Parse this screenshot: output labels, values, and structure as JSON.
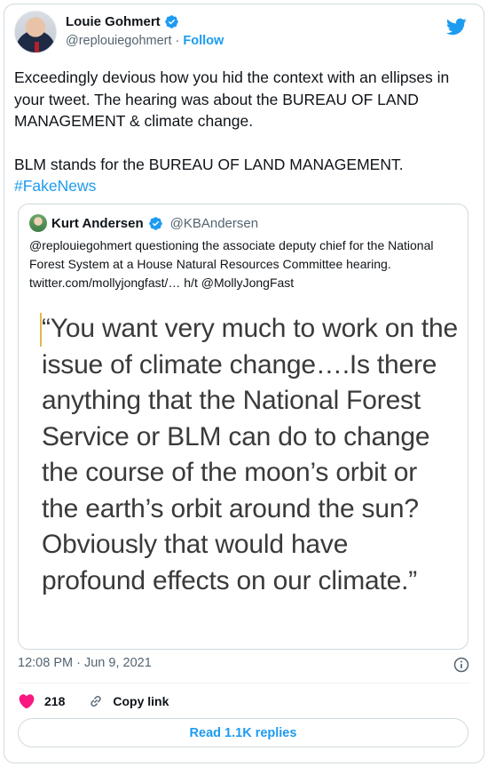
{
  "author": {
    "name": "Louie Gohmert",
    "handle": "@replouiegohmert",
    "separator": "·",
    "follow_label": "Follow"
  },
  "tweet": {
    "line1": "Exceedingly devious how you hid the context with an ellipses in your tweet. The hearing was about the BUREAU OF LAND MANAGEMENT & climate change.",
    "line2": "BLM stands for the BUREAU OF LAND MANAGEMENT.",
    "hashtag": "#FakeNews"
  },
  "quoted": {
    "name": "Kurt Andersen",
    "handle": "@KBAndersen",
    "text": "@replouiegohmert questioning the associate deputy chief for the National Forest System at a House Natural Resources Committee hearing. twitter.com/mollyjongfast/… h/t @MollyJongFast",
    "image_quote": "“You want very much to work on the issue of climate change….Is there anything that the National Forest Service or BLM can do to change the course of the moon’s orbit or the earth’s orbit around the sun? Obviously that would have profound effects on our climate.”"
  },
  "meta": {
    "time": "12:08 PM",
    "separator": "·",
    "date": "Jun 9, 2021"
  },
  "actions": {
    "likes": "218",
    "copy_link": "Copy link"
  },
  "read_replies": "Read 1.1K replies",
  "colors": {
    "accent": "#1d9bf0",
    "like": "#f91880",
    "muted": "#536471"
  },
  "icons": [
    "verified-icon",
    "twitter-bird-icon",
    "info-icon",
    "heart-icon",
    "link-icon"
  ]
}
